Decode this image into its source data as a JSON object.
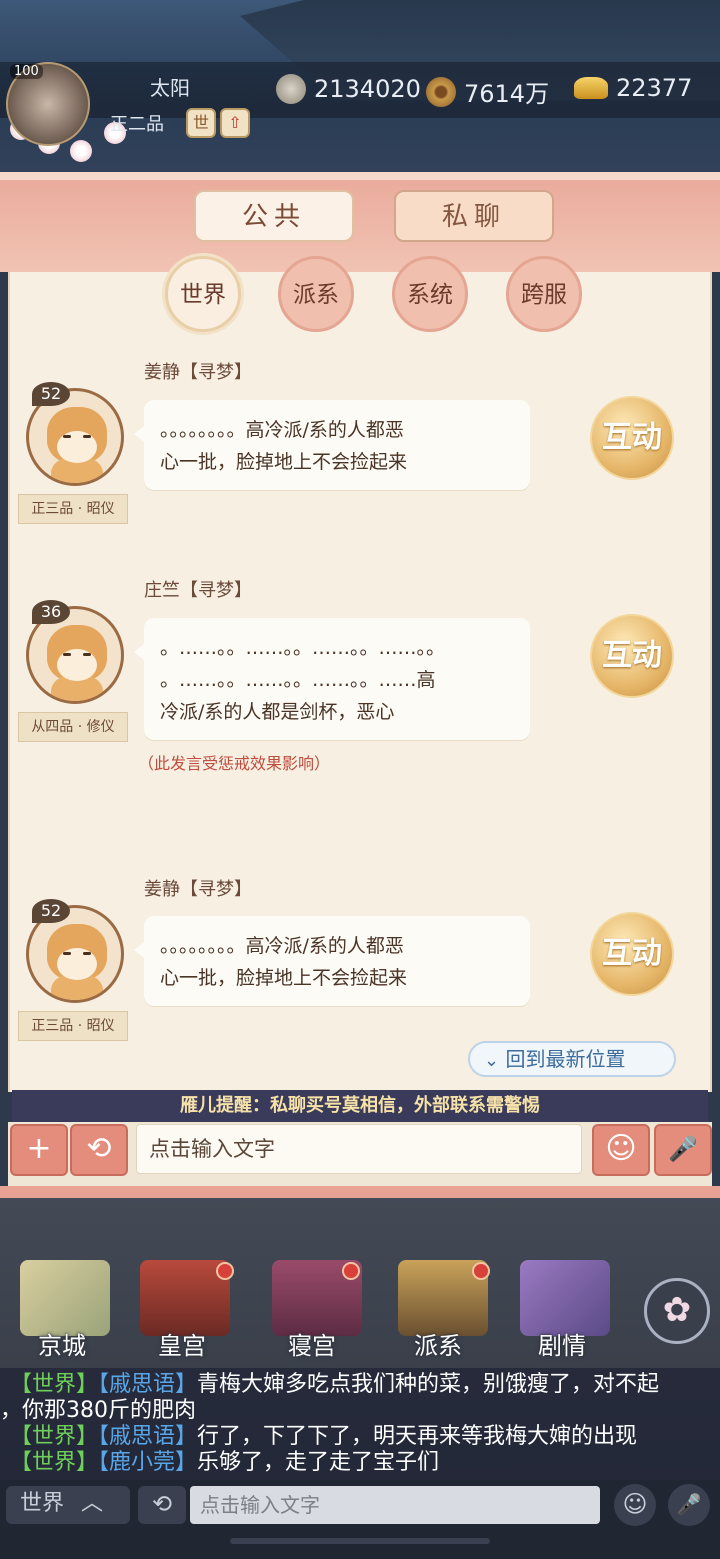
{
  "player": {
    "level": "100",
    "name": "太阳",
    "rank": "正二品",
    "rank_chip_1": "世",
    "rank_chip_2": "⇧"
  },
  "currencies": [
    {
      "icon": "silver-coin-icon",
      "value": "2134020"
    },
    {
      "icon": "copper-coin-icon",
      "value": "7614万"
    },
    {
      "icon": "gold-ingot-icon",
      "value": "22377"
    }
  ],
  "chat": {
    "top_tabs": [
      "公共",
      "私聊"
    ],
    "channels": [
      "世界",
      "派系",
      "系统",
      "跨服"
    ],
    "interact_label": "互动",
    "messages": [
      {
        "name": "姜静【寻梦】",
        "level": "52",
        "rank": "正三品 · 昭仪",
        "lines": [
          "。。。。。。。。高冷派/系的人都恶",
          "心一批，脸掉地上不会捡起来"
        ]
      },
      {
        "name": "庄竺【寻梦】",
        "level": "36",
        "rank": "从四品 · 修仪",
        "lines": [
          "。……。。……。。……。。……。。",
          "。……。。……。。……。。……高",
          "冷派/系的人都是剑杯，恶心"
        ],
        "note": "（此发言受惩戒效果影响）"
      },
      {
        "name": "姜静【寻梦】",
        "level": "52",
        "rank": "正三品 · 昭仪",
        "lines": [
          "。。。。。。。。高冷派/系的人都恶",
          "心一批，脸掉地上不会捡起来"
        ]
      }
    ],
    "back_latest": "回到最新位置",
    "notice": "雁儿提醒：私聊买号莫相信，外部联系需警惕",
    "input_placeholder": "点击输入文字",
    "plus": "+",
    "history": "⟲",
    "emoji": "☺",
    "mic": "🎤"
  },
  "nav": [
    {
      "label": "京城",
      "icon": "map-icon",
      "dot": false
    },
    {
      "label": "皇宫",
      "icon": "palace-icon",
      "dot": true
    },
    {
      "label": "寝宫",
      "icon": "bedchamber-icon",
      "dot": true
    },
    {
      "label": "派系",
      "icon": "faction-icon",
      "dot": true
    },
    {
      "label": "剧情",
      "icon": "story-book-icon",
      "dot": false
    }
  ],
  "world_chat": [
    {
      "channel": "【世界】",
      "user": "【戚思语】",
      "text": "青梅大婶多吃点我们种的菜，别饿瘦了，对不起"
    },
    {
      "channel": "",
      "user": "",
      "text": "，你那380斤的肥肉"
    },
    {
      "channel": "【世界】",
      "user": "【戚思语】",
      "text": "行了，下了下了，明天再来等我梅大婶的出现"
    },
    {
      "channel": "【世界】",
      "user": "【鹿小莞】",
      "text": "乐够了，走了走了宝子们"
    }
  ],
  "bottom_bar": {
    "channel": "世界",
    "channel_arrow": "︿",
    "history": "⟲",
    "placeholder": "点击输入文字",
    "emoji": "☺",
    "mic": "🎤"
  },
  "colors": {
    "accent": "#e48d7c",
    "panel_bg": "#f6efe2",
    "world_channel": "#6fcf5a",
    "world_user": "#59a7e8",
    "penalty": "#c04e3e"
  }
}
